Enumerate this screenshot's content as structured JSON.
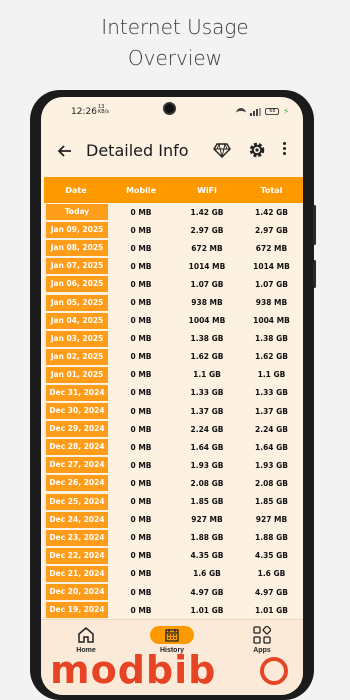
{
  "headline": {
    "line1": "Internet Usage",
    "line2": "Overview"
  },
  "status_bar": {
    "time": "12:26",
    "net_speed": "13\nKB/s",
    "battery": "68"
  },
  "app_bar": {
    "title": "Detailed Info",
    "icons": [
      "back-arrow-icon",
      "diamond-icon",
      "gear-icon",
      "more-vert-icon"
    ]
  },
  "table": {
    "headers": [
      "Date",
      "Mobile",
      "WiFi",
      "Total"
    ],
    "rows": [
      [
        "Today",
        "0 MB",
        "1.42 GB",
        "1.42 GB"
      ],
      [
        "Jan 09, 2025",
        "0 MB",
        "2.97 GB",
        "2.97 GB"
      ],
      [
        "Jan 08, 2025",
        "0 MB",
        "672 MB",
        "672 MB"
      ],
      [
        "Jan 07, 2025",
        "0 MB",
        "1014 MB",
        "1014 MB"
      ],
      [
        "Jan 06, 2025",
        "0 MB",
        "1.07 GB",
        "1.07 GB"
      ],
      [
        "Jan 05, 2025",
        "0 MB",
        "938 MB",
        "938 MB"
      ],
      [
        "Jan 04, 2025",
        "0 MB",
        "1004 MB",
        "1004 MB"
      ],
      [
        "Jan 03, 2025",
        "0 MB",
        "1.38 GB",
        "1.38 GB"
      ],
      [
        "Jan 02, 2025",
        "0 MB",
        "1.62 GB",
        "1.62 GB"
      ],
      [
        "Jan 01, 2025",
        "0 MB",
        "1.1 GB",
        "1.1 GB"
      ],
      [
        "Dec 31, 2024",
        "0 MB",
        "1.33 GB",
        "1.33 GB"
      ],
      [
        "Dec 30, 2024",
        "0 MB",
        "1.37 GB",
        "1.37 GB"
      ],
      [
        "Dec 29, 2024",
        "0 MB",
        "2.24 GB",
        "2.24 GB"
      ],
      [
        "Dec 28, 2024",
        "0 MB",
        "1.64 GB",
        "1.64 GB"
      ],
      [
        "Dec 27, 2024",
        "0 MB",
        "1.93 GB",
        "1.93 GB"
      ],
      [
        "Dec 26, 2024",
        "0 MB",
        "2.08 GB",
        "2.08 GB"
      ],
      [
        "Dec 25, 2024",
        "0 MB",
        "1.85 GB",
        "1.85 GB"
      ],
      [
        "Dec 24, 2024",
        "0 MB",
        "927 MB",
        "927 MB"
      ],
      [
        "Dec 23, 2024",
        "0 MB",
        "1.88 GB",
        "1.88 GB"
      ],
      [
        "Dec 22, 2024",
        "0 MB",
        "4.35 GB",
        "4.35 GB"
      ],
      [
        "Dec 21, 2024",
        "0 MB",
        "1.6 GB",
        "1.6 GB"
      ],
      [
        "Dec 20, 2024",
        "0 MB",
        "4.97 GB",
        "4.97 GB"
      ],
      [
        "Dec 19, 2024",
        "0 MB",
        "1.01 GB",
        "1.01 GB"
      ]
    ]
  },
  "bottom_nav": {
    "items": [
      {
        "label": "Home",
        "icon": "home-icon",
        "active": false
      },
      {
        "label": "History",
        "icon": "history-icon",
        "active": true
      },
      {
        "label": "Apps",
        "icon": "apps-grid-icon",
        "active": false
      }
    ]
  },
  "watermark": {
    "text": "modbib"
  },
  "colors": {
    "accent": "#ff9900",
    "background": "#fdf1e2",
    "watermark": "#e64425"
  }
}
